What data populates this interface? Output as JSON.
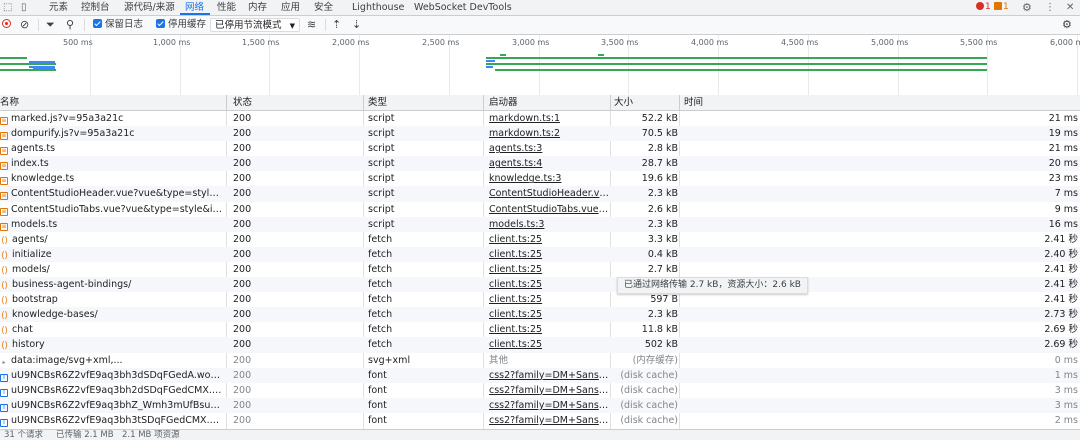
{
  "tabs": [
    {
      "label": "元素"
    },
    {
      "label": "控制台"
    },
    {
      "label": "源代码/来源"
    },
    {
      "label": "网络"
    },
    {
      "label": "性能"
    },
    {
      "label": "内存"
    },
    {
      "label": "应用"
    },
    {
      "label": "安全"
    },
    {
      "label": "Lighthouse"
    },
    {
      "label": "WebSocket DevTools"
    }
  ],
  "active_tab": "网络",
  "errors_count": "1",
  "warnings_count": "1",
  "toolbar": {
    "preserve_log": "保留日志",
    "disable_cache": "停用缓存",
    "throttling": "已停用节流模式"
  },
  "timeline_ticks": [
    "500 ms",
    "1,000 ms",
    "1,500 ms",
    "2,000 ms",
    "2,500 ms",
    "3,000 ms",
    "3,500 ms",
    "4,000 ms",
    "4,500 ms",
    "5,000 ms",
    "5,500 ms",
    "6,000 ms"
  ],
  "columns": {
    "name": "名称",
    "status": "状态",
    "type": "类型",
    "initiator": "启动器",
    "size": "大小",
    "time": "时间"
  },
  "rows": [
    {
      "name": "marked.js?v=95a3a21c",
      "status": "200",
      "type": "script",
      "initiator": "markdown.ts:1",
      "size": "52.2 kB",
      "time": "21 ms",
      "kind": "script"
    },
    {
      "name": "dompurify.js?v=95a3a21c",
      "status": "200",
      "type": "script",
      "initiator": "markdown.ts:2",
      "size": "70.5 kB",
      "time": "19 ms",
      "kind": "script"
    },
    {
      "name": "agents.ts",
      "status": "200",
      "type": "script",
      "initiator": "agents.ts:3",
      "size": "2.8 kB",
      "time": "21 ms",
      "kind": "script"
    },
    {
      "name": "index.ts",
      "status": "200",
      "type": "script",
      "initiator": "agents.ts:4",
      "size": "28.7 kB",
      "time": "20 ms",
      "kind": "script"
    },
    {
      "name": "knowledge.ts",
      "status": "200",
      "type": "script",
      "initiator": "knowledge.ts:3",
      "size": "19.6 kB",
      "time": "23 ms",
      "kind": "script"
    },
    {
      "name": "ContentStudioHeader.vue?vue&type=style&index=...",
      "status": "200",
      "type": "script",
      "initiator": "ContentStudioHeader.vue:87",
      "size": "2.3 kB",
      "time": "7 ms",
      "kind": "script"
    },
    {
      "name": "ContentStudioTabs.vue?vue&type=style&index=0&...",
      "status": "200",
      "type": "script",
      "initiator": "ContentStudioTabs.vue:76",
      "size": "2.6 kB",
      "time": "9 ms",
      "kind": "script"
    },
    {
      "name": "models.ts",
      "status": "200",
      "type": "script",
      "initiator": "models.ts:3",
      "size": "2.3 kB",
      "time": "16 ms",
      "kind": "script"
    },
    {
      "name": "agents/",
      "status": "200",
      "type": "fetch",
      "initiator": "client.ts:25",
      "size": "3.3 kB",
      "time": "2.41 秒",
      "kind": "fetch"
    },
    {
      "name": "initialize",
      "status": "200",
      "type": "fetch",
      "initiator": "client.ts:25",
      "size": "0.4 kB",
      "time": "2.40 秒",
      "kind": "fetch"
    },
    {
      "name": "models/",
      "status": "200",
      "type": "fetch",
      "initiator": "client.ts:25",
      "size": "2.7 kB",
      "time": "2.41 秒",
      "kind": "fetch"
    },
    {
      "name": "business-agent-bindings/",
      "status": "200",
      "type": "fetch",
      "initiator": "client.ts:25",
      "size": "",
      "time": "2.41 秒",
      "kind": "fetch"
    },
    {
      "name": "bootstrap",
      "status": "200",
      "type": "fetch",
      "initiator": "client.ts:25",
      "size": "597 B",
      "time": "2.41 秒",
      "kind": "fetch"
    },
    {
      "name": "knowledge-bases/",
      "status": "200",
      "type": "fetch",
      "initiator": "client.ts:25",
      "size": "2.3 kB",
      "time": "2.73 秒",
      "kind": "fetch"
    },
    {
      "name": "chat",
      "status": "200",
      "type": "fetch",
      "initiator": "client.ts:25",
      "size": "11.8 kB",
      "time": "2.69 秒",
      "kind": "fetch"
    },
    {
      "name": "history",
      "status": "200",
      "type": "fetch",
      "initiator": "client.ts:25",
      "size": "502 kB",
      "time": "2.69 秒",
      "kind": "fetch"
    },
    {
      "name": "data:image/svg+xml,...",
      "status": "200",
      "type": "svg+xml",
      "initiator": "其他",
      "size": "(内存缓存)",
      "time": "0 ms",
      "kind": "svg"
    },
    {
      "name": "uU9NCBsR6Z2vfE9aq3bh3dSDqFGedA.woff2",
      "status": "200",
      "type": "font",
      "initiator": "css2?family=DM+Sans:ital,ops",
      "size": "(disk cache)",
      "time": "1 ms",
      "kind": "font"
    },
    {
      "name": "uU9NCBsR6Z2vfE9aq3bh2dSDqFGedCMX.woff2",
      "status": "200",
      "type": "font",
      "initiator": "css2?family=DM+Sans:ital,ops",
      "size": "(disk cache)",
      "time": "3 ms",
      "kind": "font"
    },
    {
      "name": "uU9NCBsR6Z2vfE9aq3bhZ_Wmh3mUfBsu_Q.woff2",
      "status": "200",
      "type": "font",
      "initiator": "css2?family=DM+Sans:ital,ops",
      "size": "(disk cache)",
      "time": "3 ms",
      "kind": "font"
    },
    {
      "name": "uU9NCBsR6Z2vfE9aq3bh3tSDqFGedCMX.woff2",
      "status": "200",
      "type": "font",
      "initiator": "css2?family=DM+Sans:ital,ops",
      "size": "(disk cache)",
      "time": "2 ms",
      "kind": "font"
    }
  ],
  "tooltip": "已通过网络传输 2.7 kB，资源大小：2.6 kB",
  "statusbar": {
    "requests": "31 个请求",
    "transferred": "已传输 2.1 MB",
    "resources": "2.1 MB 项资源"
  },
  "colors": {
    "accent": "#1a73e8",
    "error": "#d93025",
    "warning": "#e37400",
    "bar_green": "#34a853",
    "bar_blue": "#4285f4"
  }
}
